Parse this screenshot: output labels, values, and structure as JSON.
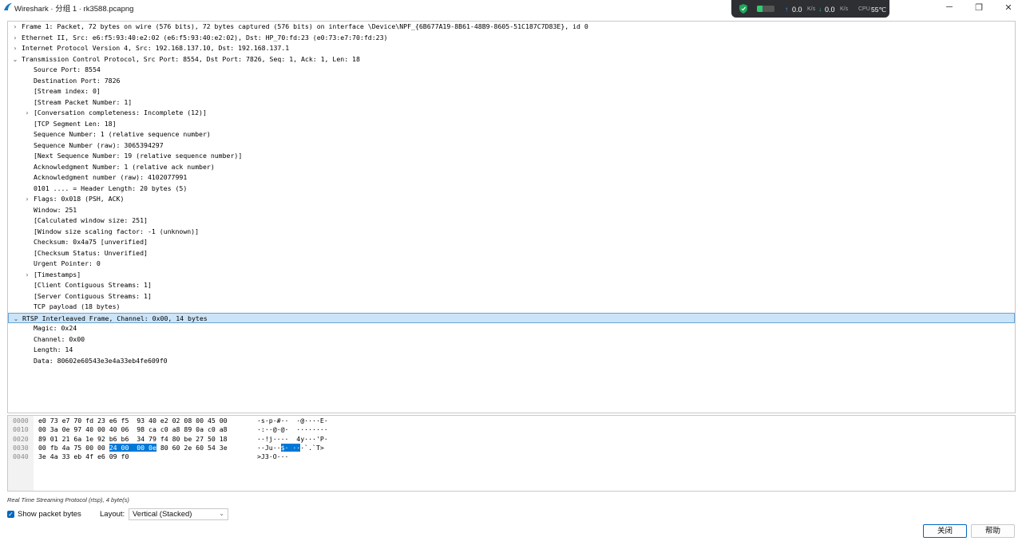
{
  "window": {
    "title": "Wireshark · 分组 1 · rk3588.pcapng",
    "minimize": "─",
    "maximize": "❐",
    "close": "✕"
  },
  "netmon": {
    "upload": "0.0",
    "upload_unit": "K/s",
    "download": "0.0",
    "download_unit": "K/s",
    "cpu_label": "CPU",
    "cpu_value": "55℃"
  },
  "tree": [
    {
      "indent": 0,
      "expander": "collapsed",
      "text": "Frame 1: Packet, 72 bytes on wire (576 bits), 72 bytes captured (576 bits) on interface \\Device\\NPF_{6B677A19-8B61-48B9-8605-51C187C7D83E}, id 0"
    },
    {
      "indent": 0,
      "expander": "collapsed",
      "text": "Ethernet II, Src: e6:f5:93:40:e2:02 (e6:f5:93:40:e2:02), Dst: HP_70:fd:23 (e0:73:e7:70:fd:23)"
    },
    {
      "indent": 0,
      "expander": "collapsed",
      "text": "Internet Protocol Version 4, Src: 192.168.137.10, Dst: 192.168.137.1"
    },
    {
      "indent": 0,
      "expander": "expanded",
      "text": "Transmission Control Protocol, Src Port: 8554, Dst Port: 7826, Seq: 1, Ack: 1, Len: 18"
    },
    {
      "indent": 1,
      "expander": "none",
      "text": "Source Port: 8554"
    },
    {
      "indent": 1,
      "expander": "none",
      "text": "Destination Port: 7826"
    },
    {
      "indent": 1,
      "expander": "none",
      "text": "[Stream index: 0]"
    },
    {
      "indent": 1,
      "expander": "none",
      "text": "[Stream Packet Number: 1]"
    },
    {
      "indent": 1,
      "expander": "collapsed",
      "text": "[Conversation completeness: Incomplete (12)]"
    },
    {
      "indent": 1,
      "expander": "none",
      "text": "[TCP Segment Len: 18]"
    },
    {
      "indent": 1,
      "expander": "none",
      "text": "Sequence Number: 1    (relative sequence number)"
    },
    {
      "indent": 1,
      "expander": "none",
      "text": "Sequence Number (raw): 3065394297"
    },
    {
      "indent": 1,
      "expander": "none",
      "text": "[Next Sequence Number: 19    (relative sequence number)]"
    },
    {
      "indent": 1,
      "expander": "none",
      "text": "Acknowledgment Number: 1    (relative ack number)"
    },
    {
      "indent": 1,
      "expander": "none",
      "text": "Acknowledgment number (raw): 4102077991"
    },
    {
      "indent": 1,
      "expander": "none",
      "text": "0101 .... = Header Length: 20 bytes (5)"
    },
    {
      "indent": 1,
      "expander": "collapsed",
      "text": "Flags: 0x018 (PSH, ACK)"
    },
    {
      "indent": 1,
      "expander": "none",
      "text": "Window: 251"
    },
    {
      "indent": 1,
      "expander": "none",
      "text": "[Calculated window size: 251]"
    },
    {
      "indent": 1,
      "expander": "none",
      "text": "[Window size scaling factor: -1 (unknown)]"
    },
    {
      "indent": 1,
      "expander": "none",
      "text": "Checksum: 0x4a75 [unverified]"
    },
    {
      "indent": 1,
      "expander": "none",
      "text": "[Checksum Status: Unverified]"
    },
    {
      "indent": 1,
      "expander": "none",
      "text": "Urgent Pointer: 0"
    },
    {
      "indent": 1,
      "expander": "collapsed",
      "text": "[Timestamps]"
    },
    {
      "indent": 1,
      "expander": "none",
      "text": "[Client Contiguous Streams: 1]"
    },
    {
      "indent": 1,
      "expander": "none",
      "text": "[Server Contiguous Streams: 1]"
    },
    {
      "indent": 1,
      "expander": "none",
      "text": "TCP payload (18 bytes)"
    },
    {
      "indent": 0,
      "expander": "expanded",
      "selected": true,
      "text": "RTSP Interleaved Frame, Channel: 0x00, 14 bytes"
    },
    {
      "indent": 1,
      "expander": "none",
      "text": "Magic: 0x24"
    },
    {
      "indent": 1,
      "expander": "none",
      "text": "Channel: 0x00"
    },
    {
      "indent": 1,
      "expander": "none",
      "text": "Length: 14"
    },
    {
      "indent": 1,
      "expander": "none",
      "text": "Data: 80602e60543e3e4a33eb4fe609f0"
    }
  ],
  "bytes": [
    {
      "offset": "0000",
      "hex_pre": "e0 73 e7 70 fd 23 e6 f5  93 40 e2 02 08 00 45 00",
      "hex_hl": "",
      "hex_post": "",
      "ascii_pre": "·s·p·#··  ·@····E·",
      "ascii_hl": "",
      "ascii_post": ""
    },
    {
      "offset": "0010",
      "hex_pre": "00 3a 0e 97 40 00 40 06  98 ca c0 a8 89 0a c0 a8",
      "hex_hl": "",
      "hex_post": "",
      "ascii_pre": "·:··@·@·  ········",
      "ascii_hl": "",
      "ascii_post": ""
    },
    {
      "offset": "0020",
      "hex_pre": "89 01 21 6a 1e 92 b6 b6  34 79 f4 80 be 27 50 18",
      "hex_hl": "",
      "hex_post": "",
      "ascii_pre": "··!j····  4y···'P·",
      "ascii_hl": "",
      "ascii_post": ""
    },
    {
      "offset": "0030",
      "hex_pre": "00 fb 4a 75 00 00 ",
      "hex_hl": "24 00  00 0e",
      "hex_post": " 80 60 2e 60 54 3e",
      "ascii_pre": "··Ju··",
      "ascii_hl": "$· ··",
      "ascii_post": "·`.`T>"
    },
    {
      "offset": "0040",
      "hex_pre": "3e 4a 33 eb 4f e6 09 f0",
      "hex_hl": "",
      "hex_post": "",
      "ascii_pre": ">J3·O···",
      "ascii_hl": "",
      "ascii_post": ""
    }
  ],
  "status": "Real Time Streaming Protocol (rtsp), 4 byte(s)",
  "controls": {
    "show_bytes_label": "Show packet bytes",
    "show_bytes_checked": "✓",
    "layout_label": "Layout:",
    "layout_value": "Vertical (Stacked)",
    "close_button": "关闭",
    "help_button": "帮助"
  }
}
